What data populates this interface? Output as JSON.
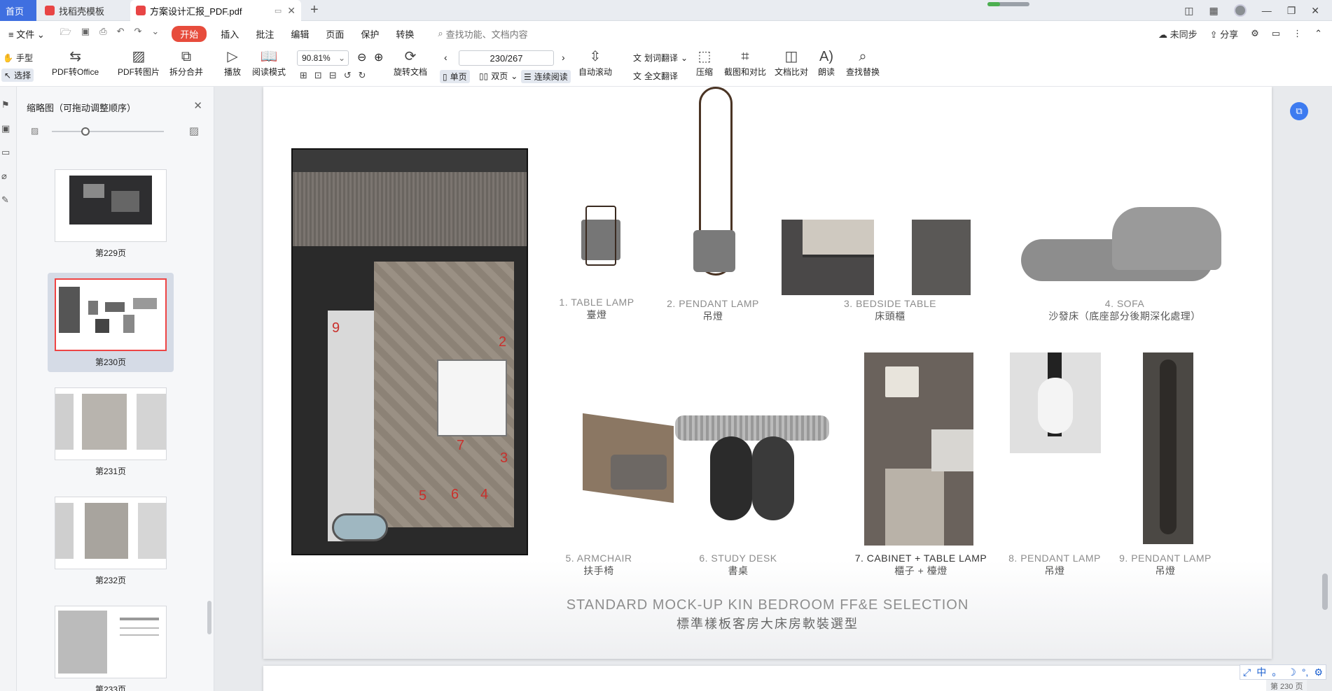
{
  "tabs": {
    "home": "首页",
    "daoke": "找稻壳模板",
    "doc": "方案设计汇报_PDF.pdf"
  },
  "menu": {
    "file": "文件",
    "items": [
      "开始",
      "插入",
      "批注",
      "编辑",
      "页面",
      "保护",
      "转换"
    ],
    "search_placeholder": "查找功能、文档内容",
    "sync": "未同步",
    "share": "分享"
  },
  "toolbar": {
    "hand": "手型",
    "select": "选择",
    "pdf_to_office": "PDF转Office",
    "pdf_to_image": "PDF转图片",
    "split_merge": "拆分合并",
    "play": "播放",
    "read_mode": "阅读模式",
    "zoom_value": "90.81%",
    "rotate": "旋转文档",
    "page_value": "230/267",
    "single": "单页",
    "double": "双页",
    "continuous": "连续阅读",
    "auto_scroll": "自动滚动",
    "word_translate": "划词翻译",
    "full_translate": "全文翻译",
    "compress": "压缩",
    "screenshot_compare": "截图和对比",
    "doc_compare": "文档比对",
    "read_aloud": "朗读",
    "find_replace": "查找替换"
  },
  "thumbnails": {
    "header": "缩略图（可拖动调整顺序）",
    "pages": [
      "第229页",
      "第230页",
      "第231页",
      "第232页",
      "第233页"
    ],
    "selected_index": 1
  },
  "document": {
    "floor_numbers": [
      "2",
      "3",
      "4",
      "5",
      "6",
      "7",
      "9"
    ],
    "captions": [
      {
        "en": "1. TABLE LAMP",
        "zh": "臺燈"
      },
      {
        "en": "2. PENDANT LAMP",
        "zh": "吊燈"
      },
      {
        "en": "3. BEDSIDE TABLE",
        "zh": "床頭櫃"
      },
      {
        "en": "4. SOFA",
        "zh": "沙發床（底座部分後期深化處理）"
      },
      {
        "en": "5. ARMCHAIR",
        "zh": "扶手椅"
      },
      {
        "en": "6. STUDY DESK",
        "zh": "書桌"
      },
      {
        "en": "7. CABINET + TABLE LAMP",
        "zh": "櫃子 + 檯燈"
      },
      {
        "en": "8. PENDANT LAMP",
        "zh": "吊燈"
      },
      {
        "en": "9. PENDANT LAMP",
        "zh": "吊燈"
      }
    ],
    "title_en": "STANDARD MOCK-UP KIN BEDROOM FF&E SELECTION",
    "title_zh": "標準樣板客房大床房軟裝選型"
  },
  "status": {
    "ime": [
      "中",
      "。",
      "☽",
      "°,",
      "⚙"
    ],
    "page_stat": "第 230 页"
  },
  "colors": {
    "accent": "#3f6fe0",
    "start_red": "#e74c3c",
    "selection_border": "#e44444"
  }
}
